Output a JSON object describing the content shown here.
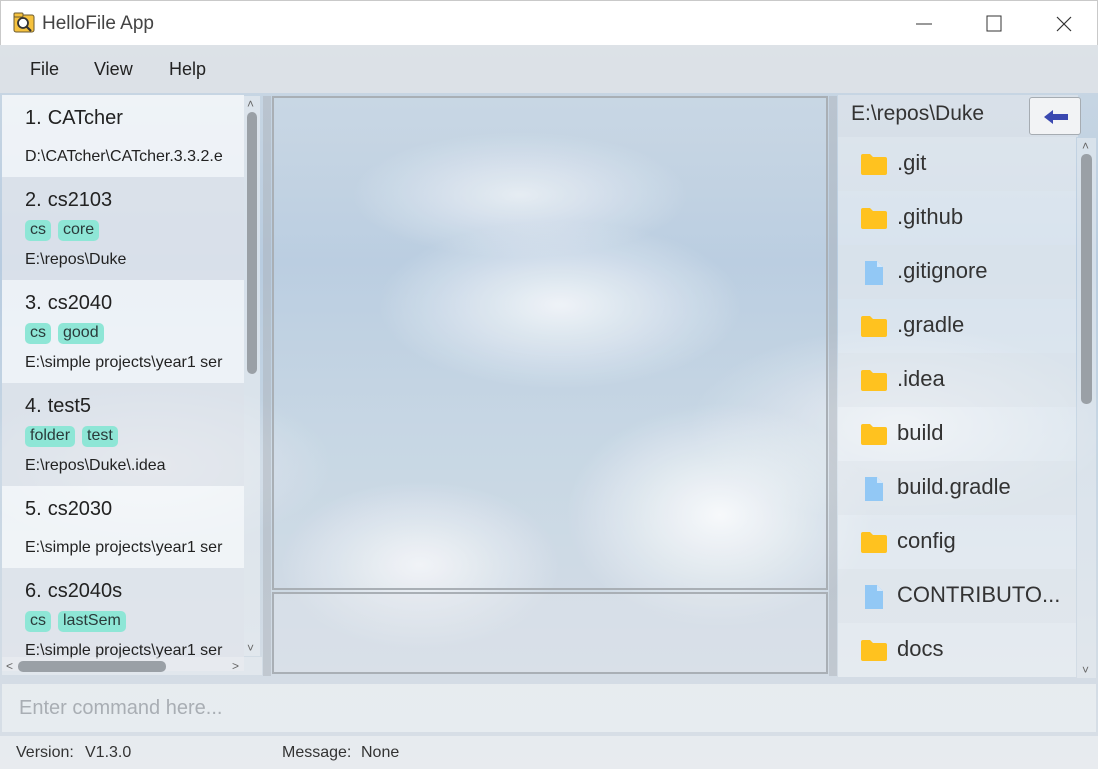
{
  "window": {
    "title": "HelloFile App"
  },
  "menu": {
    "items": [
      "File",
      "View",
      "Help"
    ]
  },
  "tagged_list": {
    "items": [
      {
        "index": "1.",
        "name": "CATcher",
        "tags": [],
        "path": "D:\\CATcher\\CATcher.3.3.2.e"
      },
      {
        "index": "2.",
        "name": "cs2103",
        "tags": [
          "cs",
          "core"
        ],
        "path": "E:\\repos\\Duke"
      },
      {
        "index": "3.",
        "name": "cs2040",
        "tags": [
          "cs",
          "good"
        ],
        "path": "E:\\simple projects\\year1 ser"
      },
      {
        "index": "4.",
        "name": "test5",
        "tags": [
          "folder",
          "test"
        ],
        "path": "E:\\repos\\Duke\\.idea"
      },
      {
        "index": "5.",
        "name": "cs2030",
        "tags": [],
        "path": "E:\\simple projects\\year1 ser"
      },
      {
        "index": "6.",
        "name": "cs2040s",
        "tags": [
          "cs",
          "lastSem"
        ],
        "path": "E:\\simple projects\\year1 ser"
      }
    ]
  },
  "file_explorer": {
    "current_dir": "E:\\repos\\Duke",
    "back_icon": "arrow-left-icon",
    "files": [
      {
        "name": ".git",
        "type": "folder"
      },
      {
        "name": ".github",
        "type": "folder"
      },
      {
        "name": ".gitignore",
        "type": "file"
      },
      {
        "name": ".gradle",
        "type": "folder"
      },
      {
        "name": ".idea",
        "type": "folder"
      },
      {
        "name": "build",
        "type": "folder"
      },
      {
        "name": "build.gradle",
        "type": "file"
      },
      {
        "name": "config",
        "type": "folder"
      },
      {
        "name": "CONTRIBUTO...",
        "type": "file"
      },
      {
        "name": "docs",
        "type": "folder"
      }
    ]
  },
  "command": {
    "placeholder": "Enter command here...",
    "value": ""
  },
  "status": {
    "version_label": "Version:",
    "version_value": "V1.3.0",
    "message_label": "Message:",
    "message_value": "None"
  },
  "colors": {
    "tag": "#8ee6d6",
    "folder": "#ffc21f",
    "file": "#92c8f5",
    "back_arrow": "#3a48b0"
  }
}
